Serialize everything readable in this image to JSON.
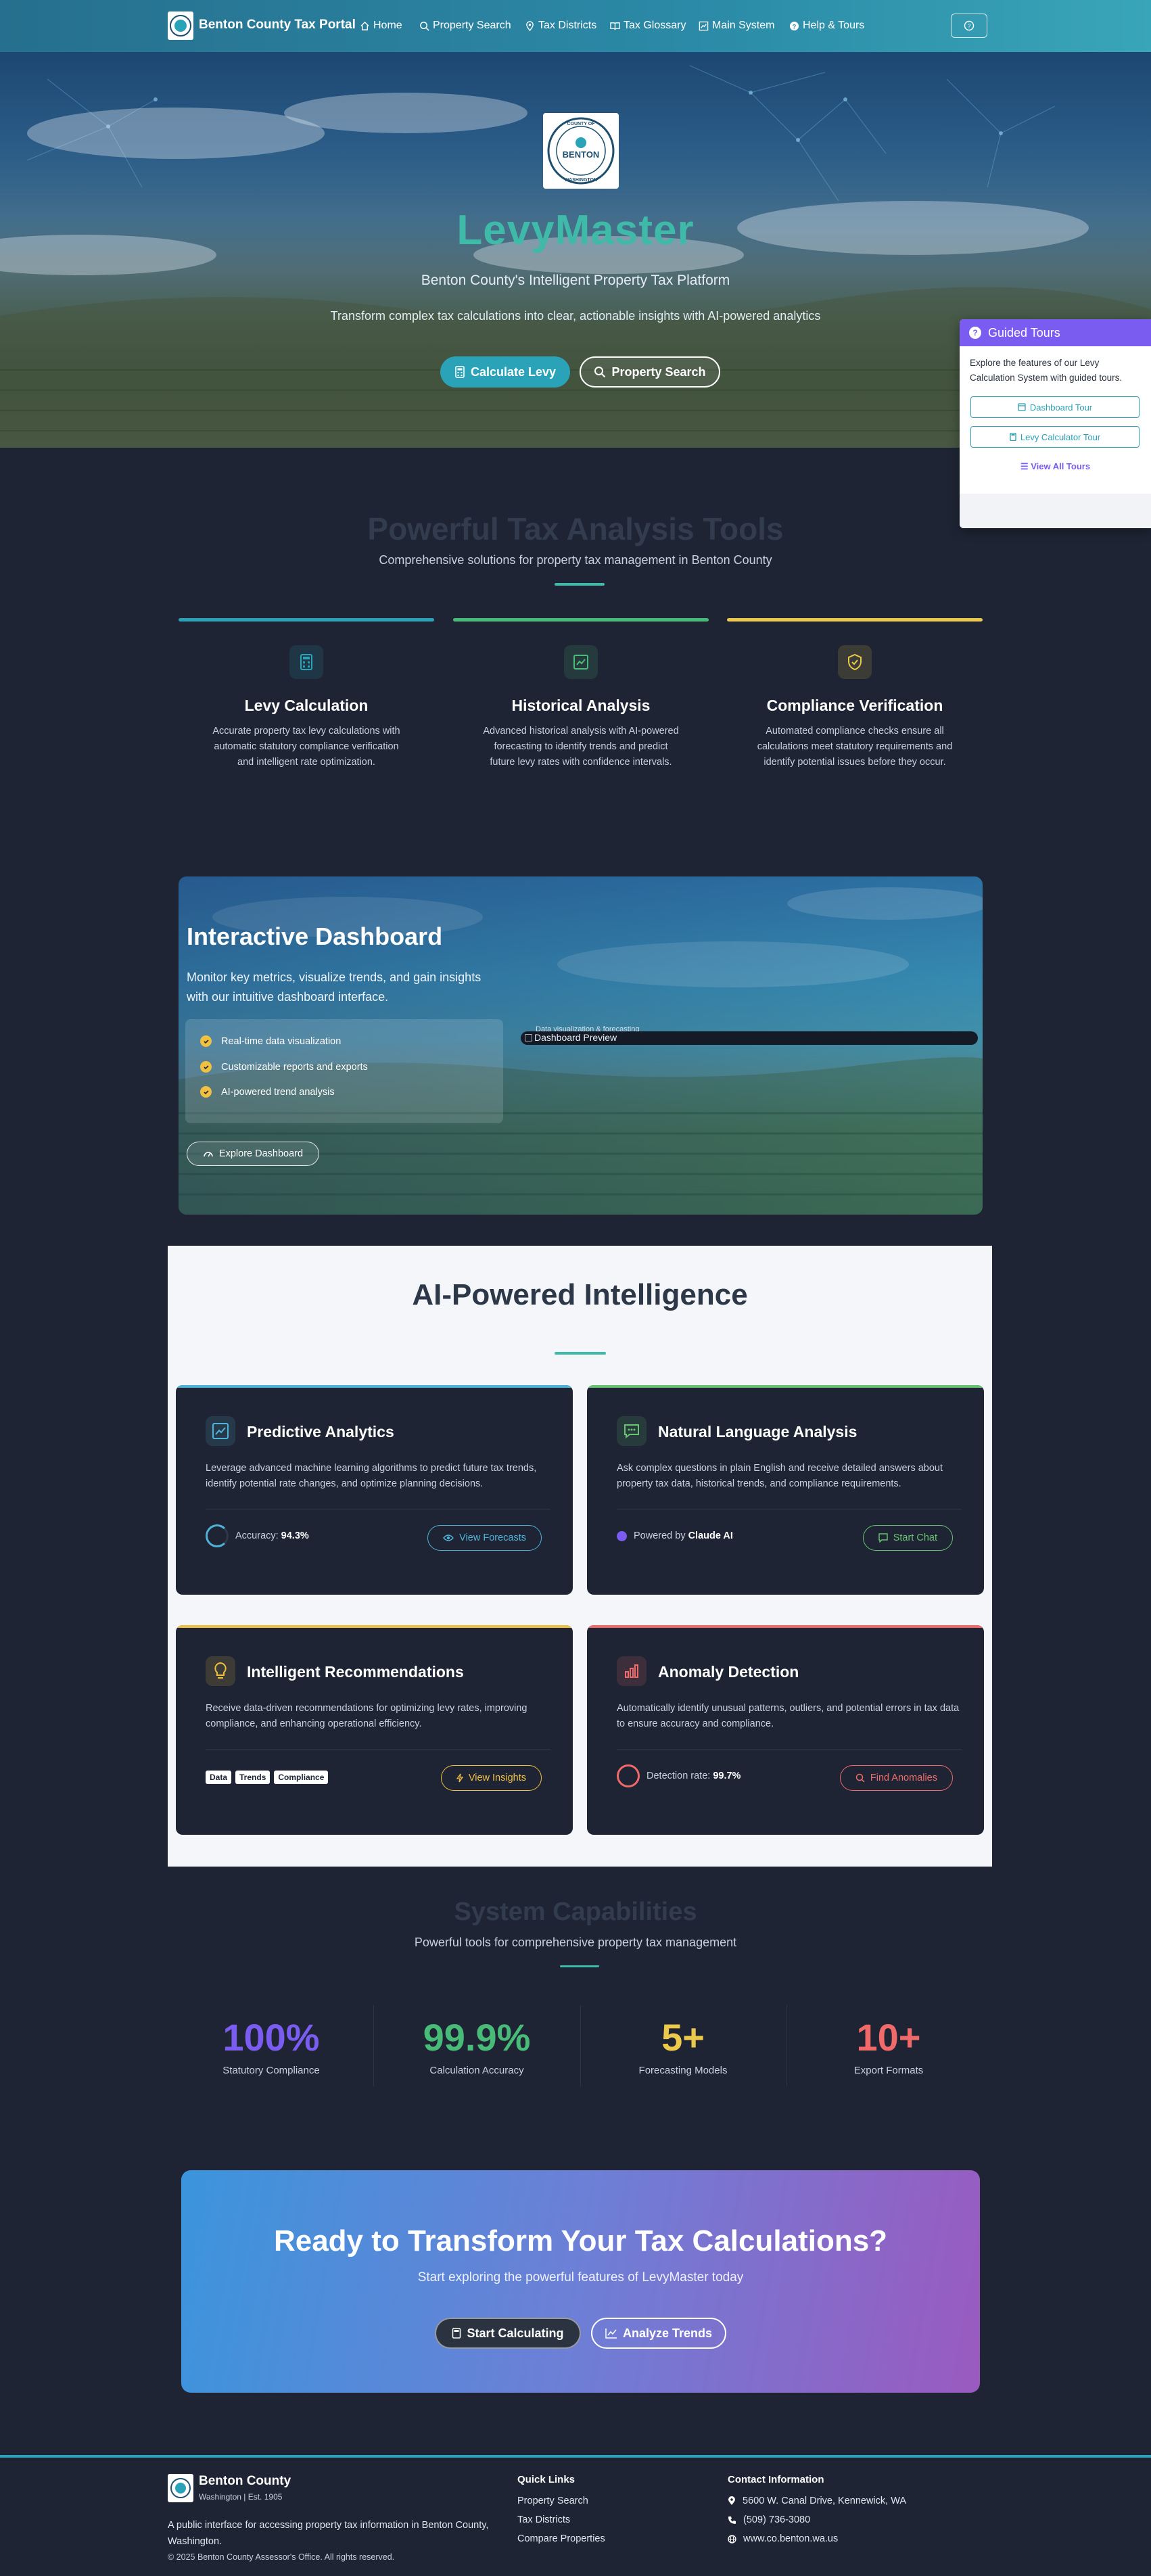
{
  "nav": {
    "brand": "Benton County Tax Portal",
    "links": [
      {
        "label": "Home",
        "icon": "home-icon"
      },
      {
        "label": "Property Search",
        "icon": "search-icon"
      },
      {
        "label": "Tax Districts",
        "icon": "map-pin-icon"
      },
      {
        "label": "Tax Glossary",
        "icon": "book-icon"
      },
      {
        "label": "Main System",
        "icon": "chart-icon"
      },
      {
        "label": "Help & Tours",
        "icon": "help-icon"
      }
    ]
  },
  "hero": {
    "seal_text": "BENTON",
    "seal_ring_top": "COUNTY OF",
    "seal_ring_bottom": "WASHINGTON",
    "title": "LevyMaster",
    "subtitle": "Benton County's Intelligent Property Tax Platform",
    "description": "Transform complex tax calculations into clear, actionable insights with AI-powered analytics",
    "primary_button": "Calculate Levy",
    "secondary_button": "Property Search"
  },
  "tours": {
    "title": "Guided Tours",
    "description": "Explore the features of our Levy Calculation System with guided tours.",
    "buttons": [
      "Dashboard Tour",
      "Levy Calculator Tour"
    ],
    "view_all": "View All Tours"
  },
  "tools": {
    "title": "Powerful Tax Analysis Tools",
    "subtitle": "Comprehensive solutions for property tax management in Benton County",
    "cards": [
      {
        "title": "Levy Calculation",
        "description": "Accurate property tax levy calculations with automatic statutory compliance verification and intelligent rate optimization.",
        "color": "#2aa3b8"
      },
      {
        "title": "Historical Analysis",
        "description": "Advanced historical analysis with AI-powered forecasting to identify trends and predict future levy rates with confidence intervals.",
        "color": "#48bb78"
      },
      {
        "title": "Compliance Verification",
        "description": "Automated compliance checks ensure all calculations meet statutory requirements and identify potential issues before they occur.",
        "color": "#ecc94b"
      }
    ]
  },
  "dashboard": {
    "title": "Interactive Dashboard",
    "description": "Monitor key metrics, visualize trends, and gain insights with our intuitive dashboard interface.",
    "features": [
      "Real-time data visualization",
      "Customizable reports and exports",
      "AI-powered trend analysis"
    ],
    "button": "Explore Dashboard",
    "preview_alt": "Dashboard Preview",
    "preview_alt_overlap": "Data visualization & forecasting"
  },
  "ai": {
    "title": "AI-Powered Intelligence",
    "cards": [
      {
        "title": "Predictive Analytics",
        "description": "Leverage advanced machine learning algorithms to predict future tax trends, identify potential rate changes, and optimize planning decisions.",
        "footer_label": "Accuracy:",
        "footer_value": "94.3%",
        "button": "View Forecasts",
        "color": "#4fb3d9"
      },
      {
        "title": "Natural Language Analysis",
        "description": "Ask complex questions in plain English and receive detailed answers about property tax data, historical trends, and compliance requirements.",
        "footer_label": "Powered by",
        "footer_value": "Claude AI",
        "button": "Start Chat",
        "color": "#68c470"
      },
      {
        "title": "Intelligent Recommendations",
        "description": "Receive data-driven recommendations for optimizing levy rates, improving compliance, and enhancing operational efficiency.",
        "tags": [
          "Data",
          "Trends",
          "Compliance"
        ],
        "button": "View Insights",
        "color": "#f0c040"
      },
      {
        "title": "Anomaly Detection",
        "description": "Automatically identify unusual patterns, outliers, and potential errors in tax data to ensure accuracy and compliance.",
        "footer_label": "Detection rate:",
        "footer_value": "99.7%",
        "button": "Find Anomalies",
        "color": "#f06a6a"
      }
    ]
  },
  "capabilities": {
    "title": "System Capabilities",
    "subtitle": "Powerful tools for comprehensive property tax management",
    "stats": [
      {
        "value": "100%",
        "label": "Statutory Compliance",
        "color": "#7a5cf0"
      },
      {
        "value": "99.9%",
        "label": "Calculation Accuracy",
        "color": "#48bb78"
      },
      {
        "value": "5+",
        "label": "Forecasting Models",
        "color": "#ecc94b"
      },
      {
        "value": "10+",
        "label": "Export Formats",
        "color": "#f06a6a"
      }
    ]
  },
  "cta": {
    "title": "Ready to Transform Your Tax Calculations?",
    "subtitle": "Start exploring the powerful features of LevyMaster today",
    "primary_button": "Start Calculating",
    "secondary_button": "Analyze Trends"
  },
  "footer": {
    "org_name": "Benton County",
    "org_sub": "Washington | Est. 1905",
    "description": "A public interface for accessing property tax information in Benton County, Washington.",
    "copyright": "© 2025 Benton County Assessor's Office. All rights reserved.",
    "quick_links_title": "Quick Links",
    "quick_links": [
      "Property Search",
      "Tax Districts",
      "Compare Properties"
    ],
    "contact_title": "Contact Information",
    "address": "5600 W. Canal Drive, Kennewick, WA",
    "phone": "(509) 736-3080",
    "website": "www.co.benton.wa.us"
  }
}
